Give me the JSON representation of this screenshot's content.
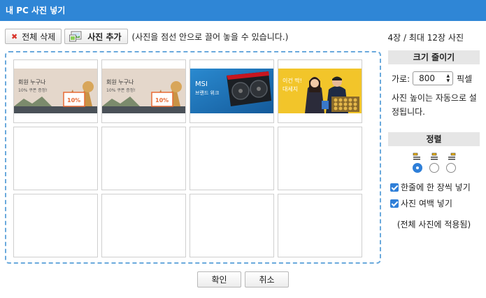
{
  "window": {
    "title": "내 PC 사진 넣기"
  },
  "toolbar": {
    "delete_all_label": "전체 삭제",
    "add_photo_label": "사진 추가",
    "hint": "(사진을 점선 안으로 끌어 놓을 수 있습니다.)",
    "photo_count": "4장 / 최대 12장 사진"
  },
  "thumbnails": {
    "t1": {
      "line1": "회원 누구나",
      "line2": "10% 쿠폰 증정!",
      "badge": "10%"
    },
    "t2": {
      "line1": "회원 누구나",
      "line2": "10% 쿠폰 증정!",
      "badge": "10%"
    },
    "t3": {
      "line1": "MSI",
      "line2": "브랜드 위크"
    },
    "t4": {
      "line1": "이건 딱!",
      "line2": "대세지"
    }
  },
  "resize": {
    "heading": "크기 줄이기",
    "width_label": "가로:",
    "width_value": "800",
    "unit": "픽셀",
    "auto_height_note": "사진 높이는 자동으로 설정됩니다."
  },
  "sort": {
    "heading": "정렬",
    "selected_index": 0,
    "options": [
      "align-left-icon",
      "align-center-icon",
      "align-right-icon"
    ]
  },
  "options": {
    "one_per_line": {
      "label": "한줄에 한 장씩 넣기",
      "checked": true
    },
    "photo_margin": {
      "label": "사진 여백 넣기",
      "checked": true
    },
    "apply_note": "(전체 사진에 적용됨)"
  },
  "footer": {
    "ok_label": "확인",
    "cancel_label": "취소"
  },
  "colors": {
    "titlebar": "#2f86d6",
    "dashed_border": "#6aa9dc",
    "accent": "#2f7fd8"
  }
}
